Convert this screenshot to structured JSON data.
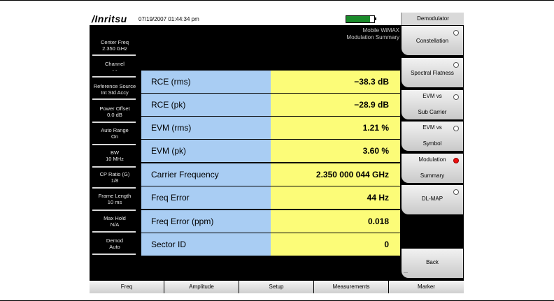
{
  "header": {
    "brand": "/Inritsu",
    "datetime": "07/19/2007 01:44:34 pm",
    "battery_level": 0.85
  },
  "mode": {
    "line1": "Mobile WiMAX",
    "line2": "Modulation Summary"
  },
  "params": [
    {
      "label": "Center Freq",
      "value": "2.350 GHz"
    },
    {
      "label": "Channel",
      "value": "- -"
    },
    {
      "label": "Reference Source",
      "value": "Int Std Accy"
    },
    {
      "label": "Power Offset",
      "value": "0.0 dB"
    },
    {
      "label": "Auto Range",
      "value": "On"
    },
    {
      "label": "BW",
      "value": "10 MHz"
    },
    {
      "label": "CP Ratio (G)",
      "value": "1/8"
    },
    {
      "label": "Frame Length",
      "value": "10 ms"
    },
    {
      "label": "Max Hold",
      "value": "N/A"
    },
    {
      "label": "Demod",
      "value": "Auto"
    }
  ],
  "summary": [
    {
      "label": "RCE (rms)",
      "value": "−38.3 dB"
    },
    {
      "label": "RCE (pk)",
      "value": "−28.9 dB"
    },
    {
      "label": "EVM (rms)",
      "value": "1.21 %"
    },
    {
      "label": "EVM (pk)",
      "value": "3.60 %"
    },
    {
      "label": "Carrier Frequency",
      "value": "2.350 000 044 GHz"
    },
    {
      "label": "Freq Error",
      "value": "44 Hz"
    },
    {
      "label": "Freq Error (ppm)",
      "value": "0.018"
    },
    {
      "label": "Sector ID",
      "value": "0"
    }
  ],
  "menu": {
    "title": "Demodulator",
    "constellation": "Constellation",
    "spectral_flatness": "Spectral Flatness",
    "evm_sub_1": "EVM vs",
    "evm_sub_2": "Sub Carrier",
    "evm_sym_1": "EVM vs",
    "evm_sym_2": "Symbol",
    "mod_sum_1": "Modulation",
    "mod_sum_2": "Summary",
    "dl_map": "DL-MAP",
    "back": "Back",
    "back_hint": "---"
  },
  "bottom": {
    "freq": "Freq",
    "amplitude": "Amplitude",
    "setup": "Setup",
    "measurements": "Measurements",
    "marker": "Marker"
  },
  "colors": {
    "label_bg": "#a9cdf3",
    "value_bg": "#fcfc78",
    "selected_radio": "#e11111"
  }
}
